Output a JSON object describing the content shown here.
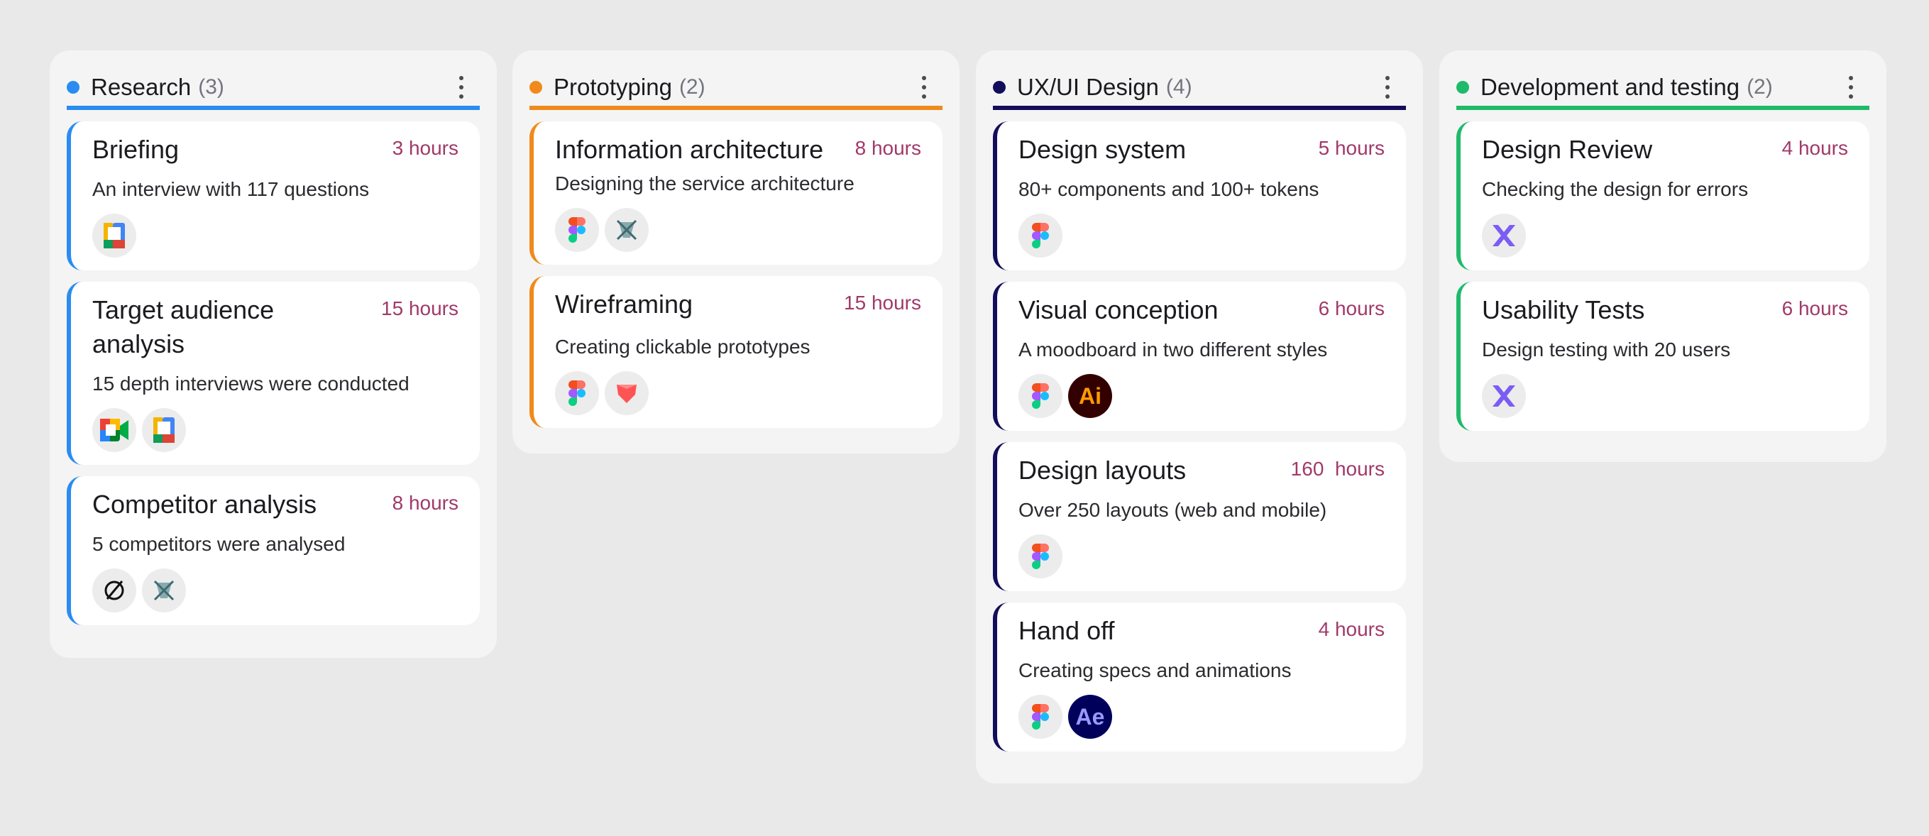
{
  "colors": {
    "research": "#2a8cf0",
    "prototyping": "#f08a1c",
    "ux": "#130d5c",
    "dev": "#1fba6a",
    "hours": "#a03a69",
    "background": "#e9e9e9",
    "column": "#f4f4f4"
  },
  "columns": [
    {
      "title": "Research",
      "count": "(3)",
      "cards": [
        {
          "title": "Briefing",
          "hours": "3 hours",
          "desc": "An interview with 117 questions",
          "tools": [
            "google-docs-icon"
          ]
        },
        {
          "title": "Target audience analysis",
          "hours": "15 hours",
          "desc": "15 depth interviews were conducted",
          "tools": [
            "google-meet-icon",
            "google-docs-icon"
          ]
        },
        {
          "title": "Competitor analysis",
          "hours": "8 hours",
          "desc": "5 competitors were analysed",
          "tools": [
            "no-symbol-icon",
            "crossed-tool-icon"
          ]
        }
      ]
    },
    {
      "title": "Prototyping",
      "count": "(2)",
      "cards": [
        {
          "title": "Information architecture",
          "hours": "8 hours",
          "desc": "Designing the service architecture",
          "tools": [
            "figma-icon",
            "crossed-tool-icon"
          ]
        },
        {
          "title": "Wireframing",
          "hours": "15 hours",
          "desc": "Creating clickable prototypes",
          "tools": [
            "figma-icon",
            "protopie-icon"
          ]
        }
      ]
    },
    {
      "title": "UX/UI Design",
      "count": "(4)",
      "cards": [
        {
          "title": "Design system",
          "hours": "5 hours",
          "desc": "80+ components and 100+ tokens",
          "tools": [
            "figma-icon"
          ]
        },
        {
          "title": "Visual conception",
          "hours": "6 hours",
          "desc": "A moodboard in two different styles",
          "tools": [
            "figma-icon",
            "illustrator-icon"
          ]
        },
        {
          "title": "Design layouts",
          "hours": "160  hours",
          "desc": "Over 250 layouts (web and mobile)",
          "tools": [
            "figma-icon"
          ]
        },
        {
          "title": "Hand off",
          "hours": "4 hours",
          "desc": "Creating specs and animations",
          "tools": [
            "figma-icon",
            "after-effects-icon"
          ]
        }
      ]
    },
    {
      "title": "Development and testing",
      "count": "(2)",
      "cards": [
        {
          "title": "Design Review",
          "hours": "4 hours",
          "desc": "Checking the design for errors",
          "tools": [
            "maze-icon"
          ]
        },
        {
          "title": "Usability Tests",
          "hours": "6 hours",
          "desc": "Design testing with 20 users",
          "tools": [
            "maze-icon"
          ]
        }
      ]
    }
  ],
  "tool_labels": {
    "illustrator": "Ai",
    "after_effects": "Ae"
  }
}
